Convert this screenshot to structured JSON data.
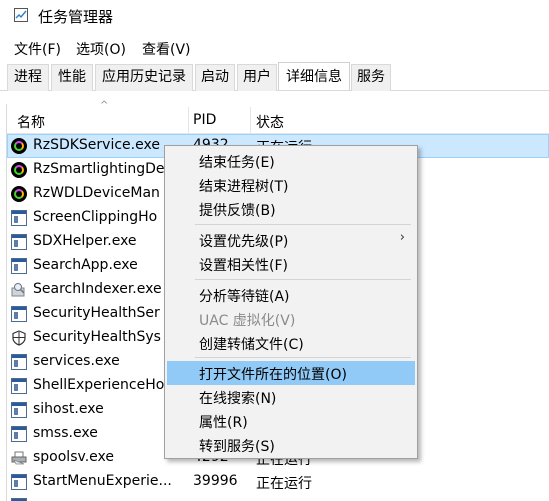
{
  "window": {
    "title": "任务管理器"
  },
  "menu": [
    "文件(F)",
    "选项(O)",
    "查看(V)"
  ],
  "tabs": [
    "进程",
    "性能",
    "应用历史记录",
    "启动",
    "用户",
    "详细信息",
    "服务"
  ],
  "active_tab": "详细信息",
  "columns": {
    "name": "名称",
    "pid": "PID",
    "status": "状态"
  },
  "rows": [
    {
      "name": "RzSDKService.exe",
      "pid": "4932",
      "status": "正在运行",
      "icon": "razer-icon",
      "selected": true
    },
    {
      "name": "RzSmartlightingDe",
      "pid": "",
      "status": "",
      "icon": "razer-icon"
    },
    {
      "name": "RzWDLDeviceMan",
      "pid": "",
      "status": "",
      "icon": "razer-icon"
    },
    {
      "name": "ScreenClippingHo",
      "pid": "",
      "status": "",
      "icon": "exe-icon"
    },
    {
      "name": "SDXHelper.exe",
      "pid": "",
      "status": "",
      "icon": "exe-icon"
    },
    {
      "name": "SearchApp.exe",
      "pid": "",
      "status": "",
      "icon": "exe-icon"
    },
    {
      "name": "SearchIndexer.exe",
      "pid": "",
      "status": "",
      "icon": "search-indexer-icon"
    },
    {
      "name": "SecurityHealthSer",
      "pid": "",
      "status": "",
      "icon": "exe-icon"
    },
    {
      "name": "SecurityHealthSys",
      "pid": "",
      "status": "",
      "icon": "shield-icon"
    },
    {
      "name": "services.exe",
      "pid": "",
      "status": "",
      "icon": "exe-icon"
    },
    {
      "name": "ShellExperienceHo",
      "pid": "",
      "status": "",
      "icon": "exe-icon"
    },
    {
      "name": "sihost.exe",
      "pid": "",
      "status": "",
      "icon": "exe-icon"
    },
    {
      "name": "smss.exe",
      "pid": "",
      "status": "",
      "icon": "exe-icon"
    },
    {
      "name": "spoolsv.exe",
      "pid": "4292",
      "status": "正在运行",
      "icon": "printer-icon"
    },
    {
      "name": "StartMenuExperie...",
      "pid": "39996",
      "status": "正在运行",
      "icon": "exe-icon"
    }
  ],
  "context_menu": {
    "group1": [
      "结束任务(E)",
      "结束进程树(T)",
      "提供反馈(B)"
    ],
    "group2": [
      "设置优先级(P)",
      "设置相关性(F)"
    ],
    "group3": [
      "分析等待链(A)",
      "UAC 虚拟化(V)",
      "创建转储文件(C)"
    ],
    "group4": [
      "打开文件所在的位置(O)",
      "在线搜索(N)",
      "属性(R)",
      "转到服务(S)"
    ],
    "submenu_arrow": "›"
  },
  "colors": {
    "selection_bg": "#cce8ff",
    "menu_hover_bg": "#91c9f7",
    "menu_bg": "#f2f2f2"
  }
}
